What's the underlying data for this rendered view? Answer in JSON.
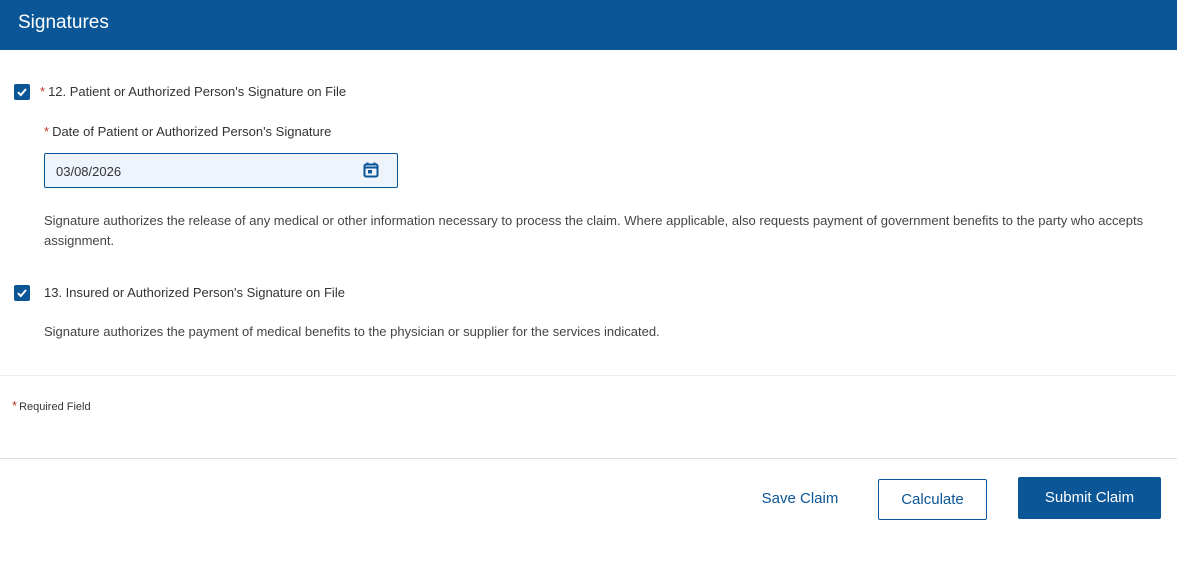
{
  "header": {
    "title": "Signatures",
    "color": "#0b5696"
  },
  "field12": {
    "checked": true,
    "required_mark": "*",
    "label": "12. Patient or Authorized Person's Signature on File"
  },
  "date_field": {
    "required_mark": "*",
    "label": "Date of Patient or Authorized Person's Signature",
    "value": "03/08/2026",
    "icon": "calendar-icon"
  },
  "field12_note": "Signature authorizes the release of any medical or other information necessary to process the claim. Where applicable, also requests payment of government benefits to the party who accepts assignment.",
  "field13": {
    "checked": true,
    "label": "13. Insured or Authorized Person's Signature on File"
  },
  "field13_note": "Signature authorizes the payment of medical benefits to the physician or supplier for the services indicated.",
  "required_note": {
    "mark": "*",
    "text": "Required Field"
  },
  "actions": {
    "save_label": "Save Claim",
    "calculate_label": "Calculate",
    "submit_label": "Submit Claim"
  },
  "colors": {
    "primary": "#0b5696",
    "required": "#c0392b"
  }
}
